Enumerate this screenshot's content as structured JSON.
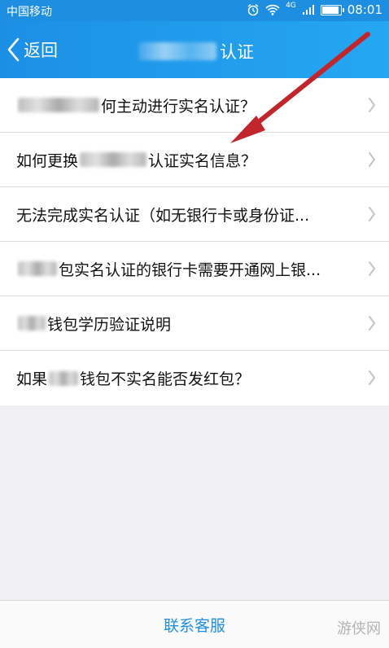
{
  "status_bar": {
    "carrier": "中国移动",
    "network": "4G",
    "time": "08:01"
  },
  "nav": {
    "back_label": "返回",
    "title_suffix": "认证"
  },
  "list": {
    "items": [
      {
        "prefix": "",
        "text": "何主动进行实名认证？"
      },
      {
        "prefix": "如何更换",
        "text": "认证实名信息？"
      },
      {
        "prefix": "",
        "text": "无法完成实名认证（如无银行卡或身份证..."
      },
      {
        "prefix": "",
        "text": "包实名认证的银行卡需要开通网上银..."
      },
      {
        "prefix": "",
        "text": "钱包学历验证说明"
      },
      {
        "prefix": "如果",
        "text": "钱包不实名能否发红包？"
      }
    ]
  },
  "footer": {
    "contact_label": "联系客服"
  },
  "watermark": "游侠网",
  "colors": {
    "accent": "#1e8fe0",
    "annotation_arrow": "#c0262c"
  }
}
